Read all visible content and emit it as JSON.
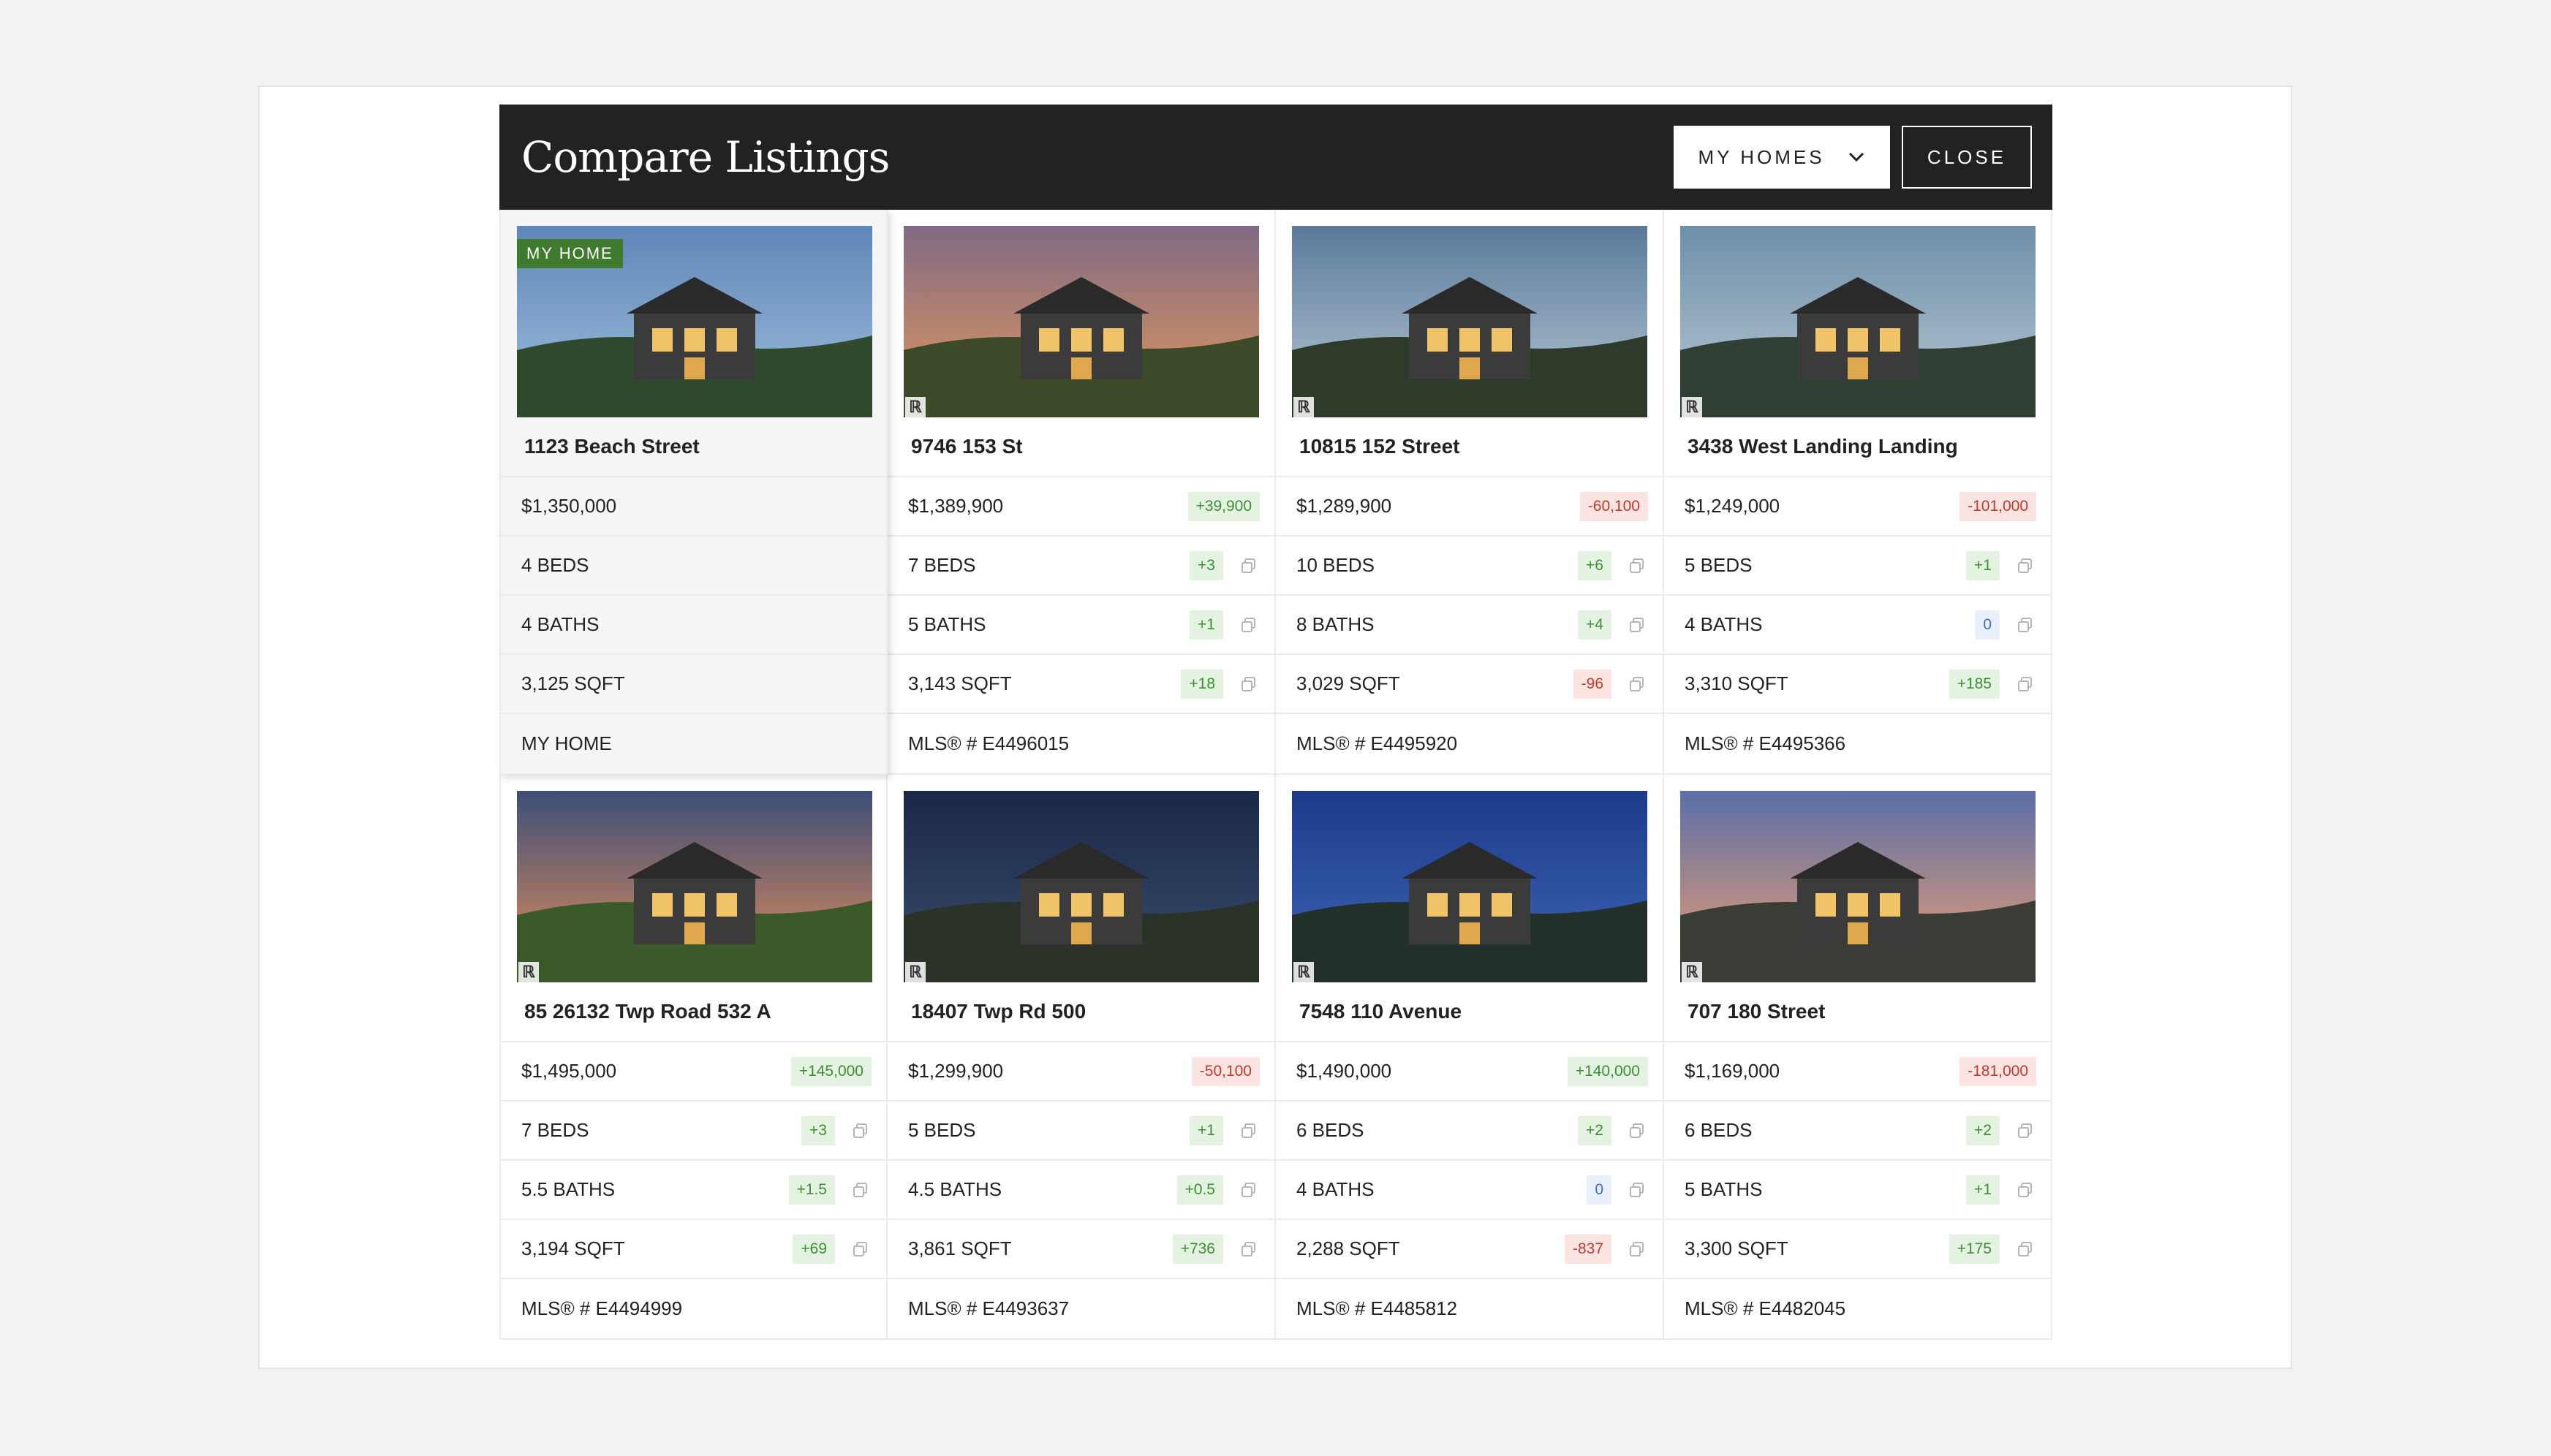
{
  "header": {
    "title": "Compare Listings",
    "my_homes_label": "MY HOMES",
    "close_label": "CLOSE"
  },
  "colors": {
    "header_bg": "#222222",
    "badge_green": "#3f7b2e",
    "positive": "#3c8d33",
    "negative": "#c0392b",
    "zero": "#3a6fc7"
  },
  "listings": [
    {
      "address": "1123 Beach Street",
      "badge": "MY HOME",
      "mine": true,
      "price": "$1,350,000",
      "price_diff": "",
      "beds": "4 BEDS",
      "beds_diff": "",
      "baths": "4 BATHS",
      "baths_diff": "",
      "sqft": "3,125 SQFT",
      "sqft_diff": "",
      "footer": "MY HOME"
    },
    {
      "address": "9746 153 St",
      "price": "$1,389,900",
      "price_diff": "+39,900",
      "beds": "7 BEDS",
      "beds_diff": "+3",
      "baths": "5 BATHS",
      "baths_diff": "+1",
      "sqft": "3,143 SQFT",
      "sqft_diff": "+18",
      "footer": "MLS® # E4496015"
    },
    {
      "address": "10815 152 Street",
      "price": "$1,289,900",
      "price_diff": "-60,100",
      "beds": "10 BEDS",
      "beds_diff": "+6",
      "baths": "8 BATHS",
      "baths_diff": "+4",
      "sqft": "3,029 SQFT",
      "sqft_diff": "-96",
      "footer": "MLS® # E4495920"
    },
    {
      "address": "3438 West Landing Landing",
      "price": "$1,249,000",
      "price_diff": "-101,000",
      "beds": "5 BEDS",
      "beds_diff": "+1",
      "baths": "4 BATHS",
      "baths_diff": "0",
      "sqft": "3,310 SQFT",
      "sqft_diff": "+185",
      "footer": "MLS® # E4495366"
    },
    {
      "address": "85 26132 Twp Road 532 A",
      "price": "$1,495,000",
      "price_diff": "+145,000",
      "beds": "7 BEDS",
      "beds_diff": "+3",
      "baths": "5.5 BATHS",
      "baths_diff": "+1.5",
      "sqft": "3,194 SQFT",
      "sqft_diff": "+69",
      "footer": "MLS® # E4494999"
    },
    {
      "address": "18407 Twp Rd 500",
      "price": "$1,299,900",
      "price_diff": "-50,100",
      "beds": "5 BEDS",
      "beds_diff": "+1",
      "baths": "4.5 BATHS",
      "baths_diff": "+0.5",
      "sqft": "3,861 SQFT",
      "sqft_diff": "+736",
      "footer": "MLS® # E4493637"
    },
    {
      "address": "7548 110 Avenue",
      "price": "$1,490,000",
      "price_diff": "+140,000",
      "beds": "6 BEDS",
      "beds_diff": "+2",
      "baths": "4 BATHS",
      "baths_diff": "0",
      "sqft": "2,288 SQFT",
      "sqft_diff": "-837",
      "footer": "MLS® # E4485812"
    },
    {
      "address": "707 180 Street",
      "price": "$1,169,000",
      "price_diff": "-181,000",
      "beds": "6 BEDS",
      "beds_diff": "+2",
      "baths": "5 BATHS",
      "baths_diff": "+1",
      "sqft": "3,300 SQFT",
      "sqft_diff": "+175",
      "footer": "MLS® # E4482045"
    }
  ]
}
